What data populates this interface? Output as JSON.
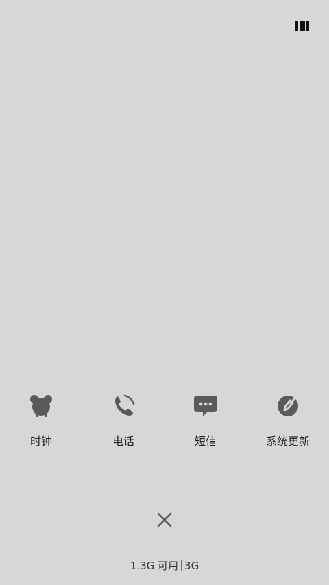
{
  "top_right": {
    "icon": "view-toggle-icon"
  },
  "recent_apps": [
    {
      "label": "时钟",
      "icon": "alarm-clock-icon"
    },
    {
      "label": "电话",
      "icon": "phone-icon"
    },
    {
      "label": "短信",
      "icon": "message-icon"
    },
    {
      "label": "系统更新",
      "icon": "system-update-icon"
    }
  ],
  "close": {
    "icon": "close-icon"
  },
  "memory": {
    "available_text": "1.3G 可用",
    "total_text": "3G"
  },
  "colors": {
    "background": "#d7d7d7",
    "icon": "#5a5a5a",
    "text": "#222222"
  }
}
